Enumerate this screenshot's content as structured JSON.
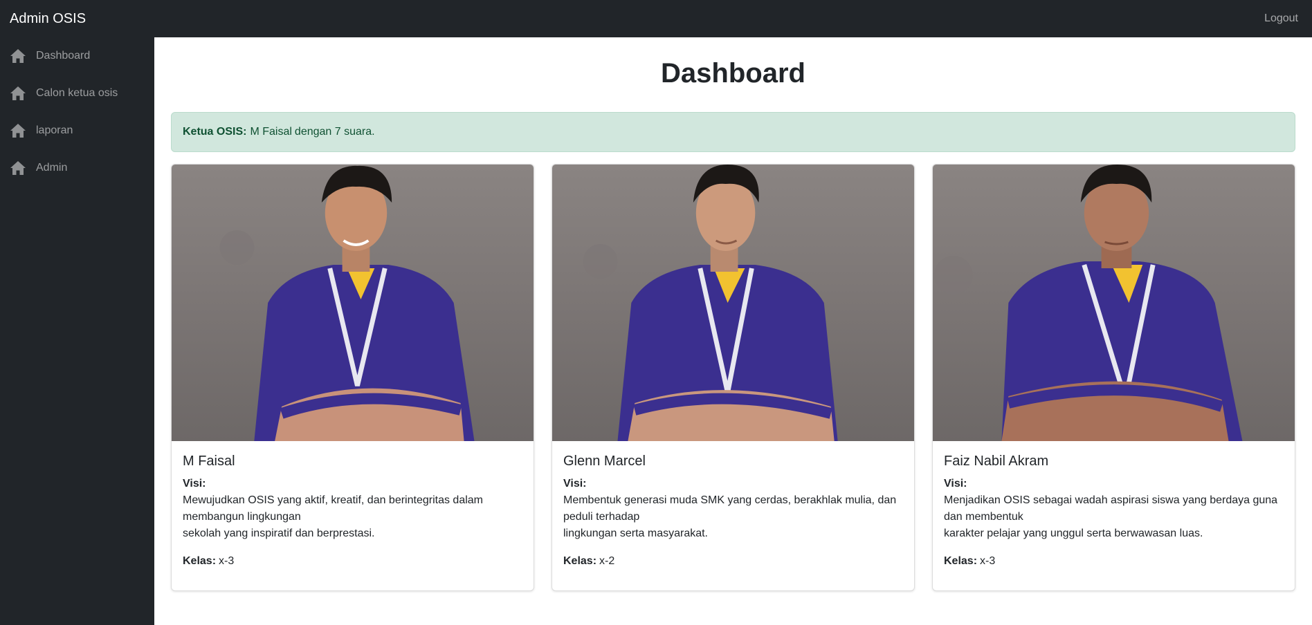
{
  "navbar": {
    "brand": "Admin OSIS",
    "logout": "Logout"
  },
  "sidebar": {
    "items": [
      {
        "label": "Dashboard",
        "icon": "home-icon"
      },
      {
        "label": "Calon ketua osis",
        "icon": "home-icon"
      },
      {
        "label": "laporan",
        "icon": "home-icon"
      },
      {
        "label": "Admin",
        "icon": "home-icon"
      }
    ]
  },
  "main": {
    "title": "Dashboard",
    "alert": {
      "label": "Ketua OSIS:",
      "name": "M Faisal",
      "suffix": "dengan 7 suara."
    },
    "cards": [
      {
        "name": "M Faisal",
        "visi_label": "Visi:",
        "visi_lines": [
          "Mewujudkan OSIS yang aktif, kreatif, dan berintegritas dalam",
          "membangun lingkungan",
          "sekolah yang inspiratif dan berprestasi."
        ],
        "kelas_label": "Kelas:",
        "kelas": "x-3"
      },
      {
        "name": "Glenn Marcel",
        "visi_label": "Visi:",
        "visi_lines": [
          "Membentuk generasi muda SMK yang cerdas, berakhlak mulia, dan",
          "peduli terhadap",
          "lingkungan serta masyarakat."
        ],
        "kelas_label": "Kelas:",
        "kelas": "x-2"
      },
      {
        "name": "Faiz Nabil Akram",
        "visi_label": "Visi:",
        "visi_lines": [
          "Menjadikan OSIS sebagai wadah aspirasi siswa yang berdaya guna",
          "dan membentuk",
          "karakter pelajar yang unggul serta berwawasan luas."
        ],
        "kelas_label": "Kelas:",
        "kelas": "x-3"
      }
    ]
  },
  "colors": {
    "navbar": "#212529",
    "alert_bg": "#d1e7dd",
    "alert_text": "#0f5132",
    "shirt": "#3b2f8f",
    "collar": "#f2c230"
  }
}
